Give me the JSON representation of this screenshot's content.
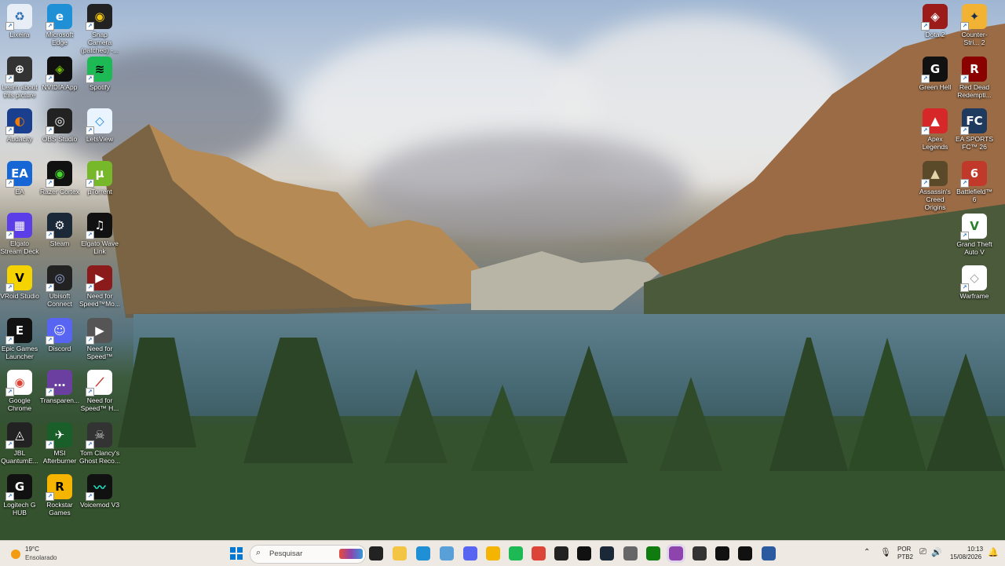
{
  "desktop": {
    "left_icons": [
      {
        "label": "Lixeira",
        "color": "#e8eef5",
        "fg": "#2d6cb3",
        "glyph": "♻"
      },
      {
        "label": "Microsoft Edge",
        "color": "#1f8fd6",
        "fg": "#fff",
        "glyph": "e"
      },
      {
        "label": "Snap Camera (patched) -...",
        "color": "#222",
        "fg": "#f1c40f",
        "glyph": "◉"
      },
      {
        "label": "Learn about this picture",
        "color": "#333",
        "fg": "#fff",
        "glyph": "⊕"
      },
      {
        "label": "NVIDIA App",
        "color": "#111",
        "fg": "#76b900",
        "glyph": "◈"
      },
      {
        "label": "Spotify",
        "color": "#1db954",
        "fg": "#000",
        "glyph": "≋"
      },
      {
        "label": "Audacity",
        "color": "#1a3f8f",
        "fg": "#f57c00",
        "glyph": "◐"
      },
      {
        "label": "OBS Studio",
        "color": "#222",
        "fg": "#fff",
        "glyph": "◎"
      },
      {
        "label": "LetsView",
        "color": "#e9f4ff",
        "fg": "#1e88e5",
        "glyph": "◇"
      },
      {
        "label": "EA",
        "color": "#1666d6",
        "fg": "#fff",
        "glyph": "EA"
      },
      {
        "label": "Razer Cortex",
        "color": "#111",
        "fg": "#44d62c",
        "glyph": "◉"
      },
      {
        "label": "µTorrent",
        "color": "#76b82a",
        "fg": "#fff",
        "glyph": "µ"
      },
      {
        "label": "Elgato Stream Deck",
        "color": "#5b3ee8",
        "fg": "#fff",
        "glyph": "▦"
      },
      {
        "label": "Steam",
        "color": "#1b2838",
        "fg": "#fff",
        "glyph": "⚙"
      },
      {
        "label": "Elgato Wave Link",
        "color": "#111",
        "fg": "#fff",
        "glyph": "♫"
      },
      {
        "label": "VRoid Studio",
        "color": "#f4d300",
        "fg": "#000",
        "glyph": "V"
      },
      {
        "label": "Ubisoft Connect",
        "color": "#222",
        "fg": "#9ad",
        "glyph": "◎"
      },
      {
        "label": "Need for Speed™Mo...",
        "color": "#8b1a1a",
        "fg": "#fff",
        "glyph": "▶"
      },
      {
        "label": "Epic Games Launcher",
        "color": "#111",
        "fg": "#fff",
        "glyph": "E"
      },
      {
        "label": "Discord",
        "color": "#5865f2",
        "fg": "#fff",
        "glyph": "☺"
      },
      {
        "label": "Need for Speed™",
        "color": "#555",
        "fg": "#fff",
        "glyph": "▶"
      },
      {
        "label": "Google Chrome",
        "color": "#fff",
        "fg": "#db4437",
        "glyph": "◉"
      },
      {
        "label": "Transparen...",
        "color": "#6b3fa0",
        "fg": "#fff",
        "glyph": "…"
      },
      {
        "label": "Need for Speed™ H...",
        "color": "#fff",
        "fg": "#c0392b",
        "glyph": "⟋"
      },
      {
        "label": "JBL QuantumE...",
        "color": "#222",
        "fg": "#fff",
        "glyph": "◬"
      },
      {
        "label": "MSI Afterburner",
        "color": "#1a5f2a",
        "fg": "#fff",
        "glyph": "✈"
      },
      {
        "label": "Tom Clancy's Ghost Reco...",
        "color": "#333",
        "fg": "#ccc",
        "glyph": "☠"
      },
      {
        "label": "Logitech G HUB",
        "color": "#111",
        "fg": "#fff",
        "glyph": "G"
      },
      {
        "label": "Rockstar Games",
        "color": "#f5b400",
        "fg": "#000",
        "glyph": "R"
      },
      {
        "label": "Voicemod V3",
        "color": "#111",
        "fg": "#1fe5c5",
        "glyph": "〰"
      }
    ],
    "right_icons": [
      {
        "label": "Dota 2",
        "color": "#9b1a1a",
        "fg": "#fff",
        "glyph": "◈"
      },
      {
        "label": "Counter-Stri... 2",
        "color": "#f2b233",
        "fg": "#1a2e4a",
        "glyph": "✦"
      },
      {
        "label": "Green Hell",
        "color": "#111",
        "fg": "#fff",
        "glyph": "G"
      },
      {
        "label": "Red Dead Redempti...",
        "color": "#8b0000",
        "fg": "#fff",
        "glyph": "R"
      },
      {
        "label": "Apex Legends",
        "color": "#d62828",
        "fg": "#fff",
        "glyph": "▲"
      },
      {
        "label": "EA SPORTS FC™ 26",
        "color": "#1e3a5f",
        "fg": "#fff",
        "glyph": "FC"
      },
      {
        "label": "Assassin's Creed Origins",
        "color": "#5a4a2a",
        "fg": "#e6d5a8",
        "glyph": "▲"
      },
      {
        "label": "Battlefield™ 6",
        "color": "#c0392b",
        "fg": "#fff",
        "glyph": "6"
      },
      {
        "label": "Grand Theft Auto V",
        "color": "#fff",
        "fg": "#2a7f2a",
        "glyph": "V"
      },
      {
        "label": "Warframe",
        "color": "#fff",
        "fg": "#999",
        "glyph": "◇"
      }
    ]
  },
  "taskbar": {
    "weather": {
      "temp": "19°C",
      "condition": "Ensolarado"
    },
    "search_placeholder": "Pesquisar",
    "pinned": [
      {
        "name": "windows-start",
        "color": "#0078d4"
      },
      {
        "name": "task-view",
        "color": "#222"
      },
      {
        "name": "file-explorer",
        "color": "#f4c542"
      },
      {
        "name": "edge",
        "color": "#1f8fd6"
      },
      {
        "name": "photos",
        "color": "#5aa0d8"
      },
      {
        "name": "discord",
        "color": "#5865f2"
      },
      {
        "name": "rockstar",
        "color": "#f5b400"
      },
      {
        "name": "spotify",
        "color": "#1db954"
      },
      {
        "name": "chrome",
        "color": "#db4437"
      },
      {
        "name": "jbl",
        "color": "#222"
      },
      {
        "name": "logitech",
        "color": "#111"
      },
      {
        "name": "steam",
        "color": "#1b2838"
      },
      {
        "name": "settings",
        "color": "#666"
      },
      {
        "name": "xbox",
        "color": "#107c10"
      },
      {
        "name": "transparent-app",
        "color": "#8e44ad"
      },
      {
        "name": "obs",
        "color": "#333"
      },
      {
        "name": "wave-link",
        "color": "#111"
      },
      {
        "name": "voicemod",
        "color": "#111"
      },
      {
        "name": "nfs",
        "color": "#2c5aa0"
      }
    ],
    "language": "POR",
    "layout": "PTB2",
    "time": "10:13",
    "date": "15/08/2026"
  }
}
